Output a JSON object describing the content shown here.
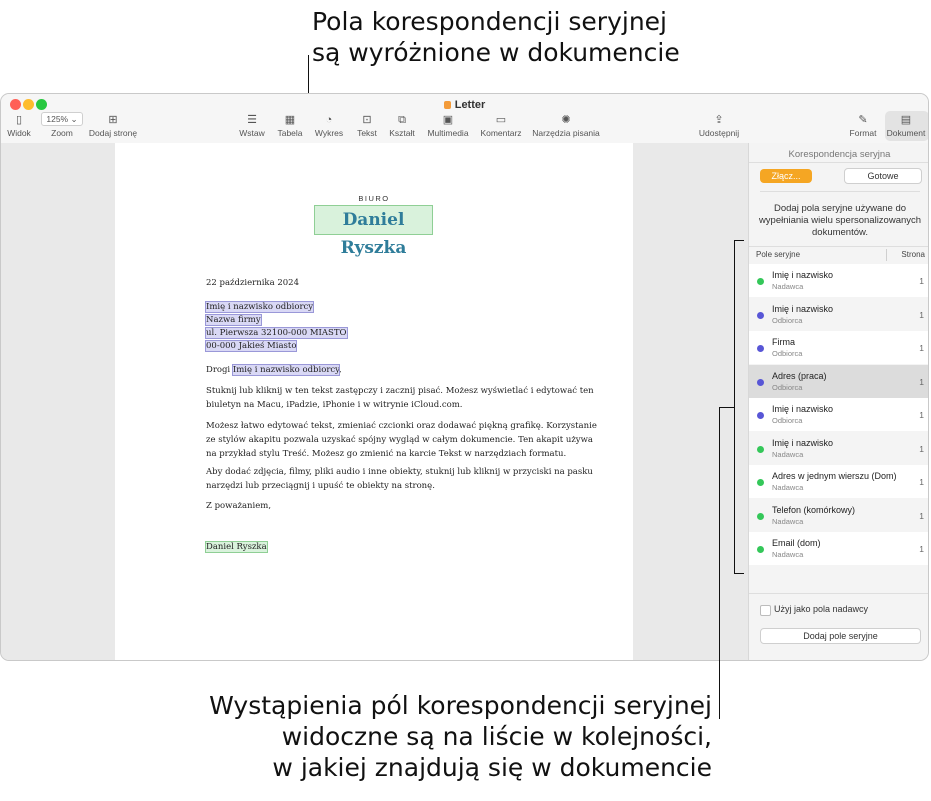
{
  "callouts": {
    "top": [
      "Pola korespondencji seryjnej",
      "są wyróżnione w dokumencie"
    ],
    "bottom": [
      "Wystąpienia pól korespondencji seryjnej",
      "widoczne są na liście w kolejności,",
      "w jakiej znajdują się w dokumencie"
    ]
  },
  "window": {
    "title": "Letter"
  },
  "toolbar": {
    "left": [
      {
        "label": "Widok",
        "icon": "sidebar-icon"
      },
      {
        "label": "Zoom",
        "value": "125% ⌄"
      },
      {
        "label": "Dodaj stronę",
        "icon": "add-page-icon"
      }
    ],
    "center": [
      {
        "label": "Wstaw",
        "icon": "insert-icon"
      },
      {
        "label": "Tabela",
        "icon": "table-icon"
      },
      {
        "label": "Wykres",
        "icon": "chart-icon"
      },
      {
        "label": "Tekst",
        "icon": "text-box-icon"
      },
      {
        "label": "Kształt",
        "icon": "shape-icon"
      },
      {
        "label": "Multimedia",
        "icon": "media-icon"
      },
      {
        "label": "Komentarz",
        "icon": "comment-icon"
      },
      {
        "label": "Narzędzia pisania",
        "icon": "writing-tools-icon"
      }
    ],
    "share": {
      "label": "Udostępnij",
      "icon": "share-icon"
    },
    "right": [
      {
        "label": "Format",
        "icon": "format-brush-icon"
      },
      {
        "label": "Dokument",
        "icon": "document-icon"
      }
    ]
  },
  "document": {
    "header_label": "BIURO",
    "sender_name": "Daniel Ryszka",
    "date": "22 października 2024",
    "recipient": {
      "name": "Imię i nazwisko odbiorcy",
      "company": "Nazwa firmy",
      "address1": "ul. Pierwsza 32100-000 MIASTO",
      "address2": "00-000 Jakieś Miasto"
    },
    "greeting_prefix": "Drogi ",
    "greeting_field": "Imię i nazwisko odbiorcy",
    "greeting_suffix": ",",
    "paragraphs": [
      [
        "Stuknij lub kliknij w ten tekst zastępczy i zacznij pisać. Możesz wyświetlać i edytować ten",
        "biuletyn na Macu, iPadzie, iPhonie i w witrynie iCloud.com."
      ],
      [
        "Możesz łatwo edytować tekst, zmieniać czcionki oraz dodawać piękną grafikę. Korzystanie",
        "ze stylów akapitu pozwala uzyskać spójny wygląd w całym dokumencie. Ten akapit używa",
        "na przykład stylu Treść. Możesz go zmienić na karcie Tekst w narzędziach formatu."
      ],
      [
        "Aby dodać zdjęcia, filmy, pliki audio i inne obiekty, stuknij lub kliknij w przyciski na pasku",
        "narzędzi lub przeciągnij i upuść te obiekty na stronę."
      ]
    ],
    "closing": "Z poważaniem,",
    "signature": "Daniel Ryszka"
  },
  "sidebar": {
    "title": "Korespondencja seryjna",
    "merge_button": "Złącz...",
    "done_button": "Gotowe",
    "description": [
      "Dodaj pola seryjne używane do",
      "wypełniania wielu spersonalizowanych",
      "dokumentów."
    ],
    "col_field": "Pole seryjne",
    "col_page": "Strona",
    "fields": [
      {
        "name": "Imię i nazwisko",
        "role": "Nadawca",
        "page": "1",
        "color": "#34c759"
      },
      {
        "name": "Imię i nazwisko",
        "role": "Odbiorca",
        "page": "1",
        "color": "#5856d6"
      },
      {
        "name": "Firma",
        "role": "Odbiorca",
        "page": "1",
        "color": "#5856d6"
      },
      {
        "name": "Adres (praca)",
        "role": "Odbiorca",
        "page": "1",
        "color": "#5856d6"
      },
      {
        "name": "Imię i nazwisko",
        "role": "Odbiorca",
        "page": "1",
        "color": "#5856d6"
      },
      {
        "name": "Imię i nazwisko",
        "role": "Nadawca",
        "page": "1",
        "color": "#34c759"
      },
      {
        "name": "Adres w jednym wierszu (Dom)",
        "role": "Nadawca",
        "page": "1",
        "color": "#34c759"
      },
      {
        "name": "Telefon (komórkowy)",
        "role": "Nadawca",
        "page": "1",
        "color": "#34c759"
      },
      {
        "name": "Email (dom)",
        "role": "Nadawca",
        "page": "1",
        "color": "#34c759"
      }
    ],
    "selected_index": 3,
    "sender_checkbox_label": "Użyj jako pola nadawcy",
    "add_field_button": "Dodaj pole seryjne"
  }
}
